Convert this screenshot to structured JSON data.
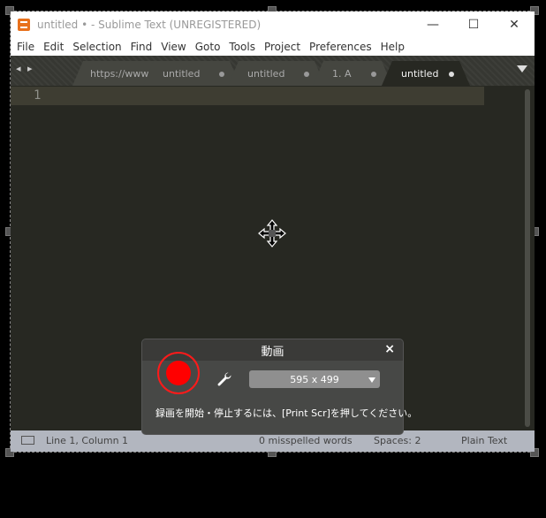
{
  "window": {
    "title": "untitled • - Sublime Text (UNREGISTERED)",
    "minimize_glyph": "—",
    "maximize_glyph": "☐",
    "close_glyph": "✕"
  },
  "menu": [
    "File",
    "Edit",
    "Selection",
    "Find",
    "View",
    "Goto",
    "Tools",
    "Project",
    "Preferences",
    "Help"
  ],
  "tabs": [
    {
      "label": "https://www.y",
      "active": false,
      "dot": false
    },
    {
      "label": "untitled",
      "active": false,
      "dot": true
    },
    {
      "label": "untitled",
      "active": false,
      "dot": true
    },
    {
      "label": "1. A",
      "active": false,
      "dot": true
    },
    {
      "label": "untitled",
      "active": true,
      "dot": true
    }
  ],
  "tab_nav": "◂ ▸",
  "editor": {
    "line_number": "1"
  },
  "status": {
    "position": "Line 1, Column 1",
    "spelling": "0 misspelled words",
    "spaces": "Spaces: 2",
    "syntax": "Plain Text"
  },
  "recorder": {
    "title": "動画",
    "close": "×",
    "size": "595 x 499",
    "hint": "録画を開始・停止するには、[Print Scr]を押してください。",
    "record_color": "#ff0000"
  },
  "colors": {
    "editor_bg": "#272822",
    "status_bg": "#b2b6bf"
  }
}
